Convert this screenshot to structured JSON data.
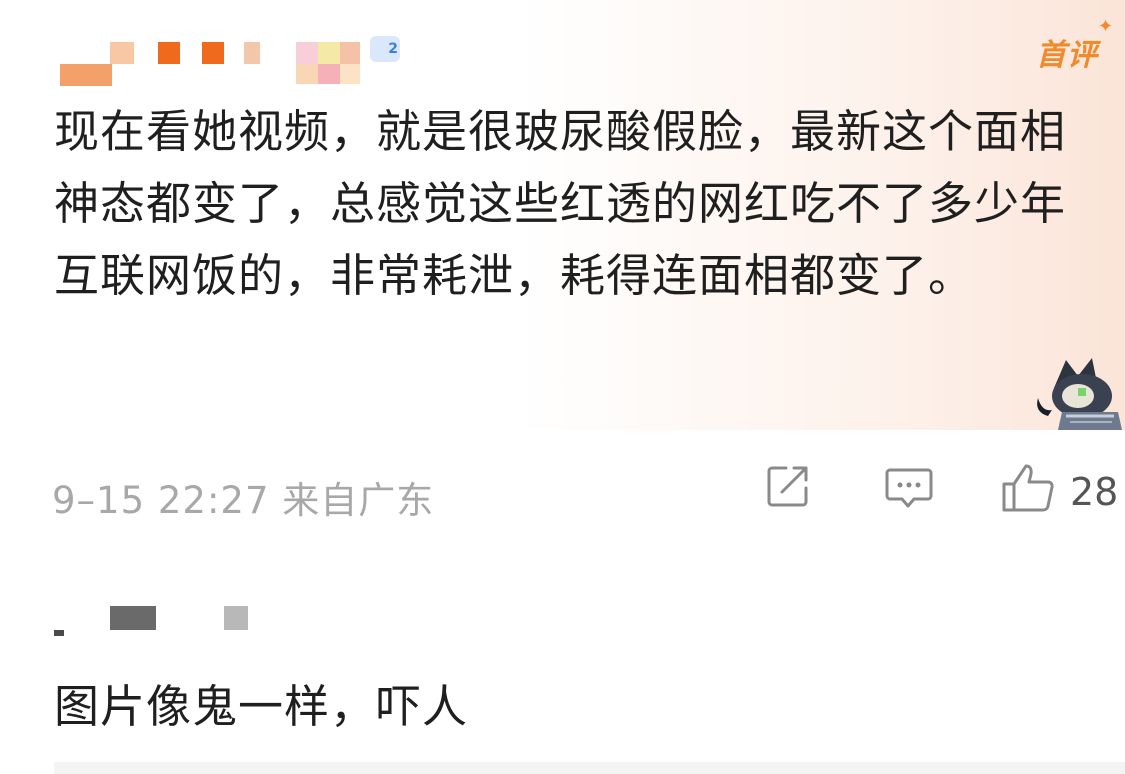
{
  "comment": {
    "level": "2",
    "badge": "首评",
    "text": "现在看她视频，就是很玻尿酸假脸，最新这个面相神态都变了，总感觉这些红透的网红吃不了多少年互联网饭的，非常耗泄，耗得连面相都变了。",
    "meta": "9–15 22:27 来自广东",
    "like_count": "28",
    "icons": {
      "share": "share-icon",
      "reply": "comment-icon",
      "like": "thumbs-up-icon",
      "sticker": "cartoon-character-sticker"
    },
    "colors": {
      "badge": "#f08a2a",
      "bubble_tint": "#fbe4d8",
      "meta": "#a8a8a8"
    }
  },
  "reply": {
    "text": "图片像鬼一样，吓人"
  }
}
